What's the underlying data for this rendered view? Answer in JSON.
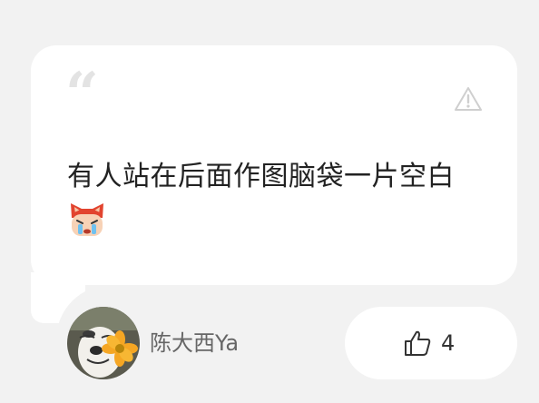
{
  "comment": {
    "quote_icon": "quote-icon",
    "report_icon": "warning-triangle-icon",
    "text": "有人站在后面作图脑袋一片空白",
    "emoji": "crying-fox-emoji"
  },
  "author": {
    "avatar": "avatar-dog-with-flower",
    "name": "陈大西Ya"
  },
  "likes": {
    "icon": "thumbs-up-icon",
    "count": "4"
  }
}
